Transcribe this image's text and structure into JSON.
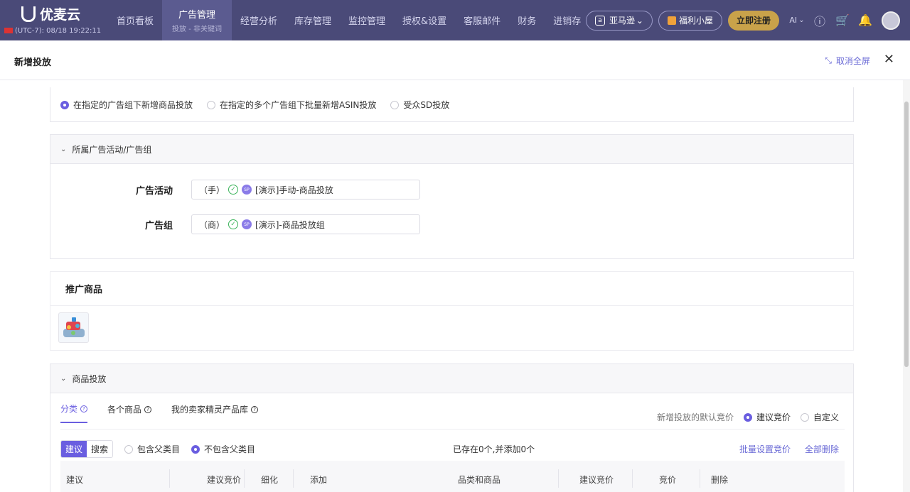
{
  "brand": {
    "name": "优麦云",
    "timezone": "(UTC-7): 08/18 19:22:11"
  },
  "nav": {
    "items": [
      {
        "label": "首页看板"
      },
      {
        "label": "广告管理",
        "sub": "投放 - 非关键词",
        "active": true
      },
      {
        "label": "经营分析"
      },
      {
        "label": "库存管理"
      },
      {
        "label": "监控管理"
      },
      {
        "label": "授权&设置"
      },
      {
        "label": "客服邮件"
      },
      {
        "label": "财务"
      },
      {
        "label": "进销存"
      }
    ],
    "marketplace": "亚马逊",
    "marketplace_icon": "a",
    "welfare": "福利小屋",
    "register": "立即注册",
    "ai_label": "AI"
  },
  "drawer": {
    "title": "新增投放",
    "exit_fullscreen": "取消全屏"
  },
  "mode": {
    "options": [
      {
        "label": "在指定的广告组下新增商品投放",
        "selected": true
      },
      {
        "label": "在指定的多个广告组下批量新增ASIN投放",
        "selected": false
      },
      {
        "label": "受众SD投放",
        "selected": false
      }
    ]
  },
  "campaign_section": {
    "title": "所属广告活动/广告组",
    "campaign_label": "广告活动",
    "campaign_prefix": "（手）",
    "campaign_value": "[演示]手动-商品投放",
    "group_label": "广告组",
    "group_prefix": "（商）",
    "group_value": "[演示]-商品投放组",
    "sp_badge": "SP"
  },
  "product_section": {
    "title": "推广商品"
  },
  "targeting": {
    "title": "商品投放",
    "tabs": [
      {
        "label": "分类",
        "active": true
      },
      {
        "label": "各个商品",
        "active": false
      },
      {
        "label": "我的卖家精灵产品库",
        "active": false
      }
    ],
    "default_bid_label": "新增投放的默认竞价",
    "bid_options": [
      {
        "label": "建议竞价",
        "selected": true
      },
      {
        "label": "自定义",
        "selected": false
      }
    ],
    "seg": [
      {
        "label": "建议",
        "on": true
      },
      {
        "label": "搜索",
        "on": false
      }
    ],
    "parent_options": [
      {
        "label": "包含父类目",
        "selected": false
      },
      {
        "label": "不包含父类目",
        "selected": true
      }
    ],
    "count_text": "已存在0个,并添加0个",
    "batch_bid": "批量设置竞价",
    "delete_all": "全部删除",
    "columns_left": [
      "建议",
      "建议竞价",
      "细化",
      "添加"
    ],
    "columns_right": [
      "品类和商品",
      "建议竞价",
      "竞价",
      "删除"
    ]
  },
  "colors": {
    "nav_bg": "#4a4a78",
    "accent": "#6a5ee0",
    "register": "#c9a24a"
  }
}
